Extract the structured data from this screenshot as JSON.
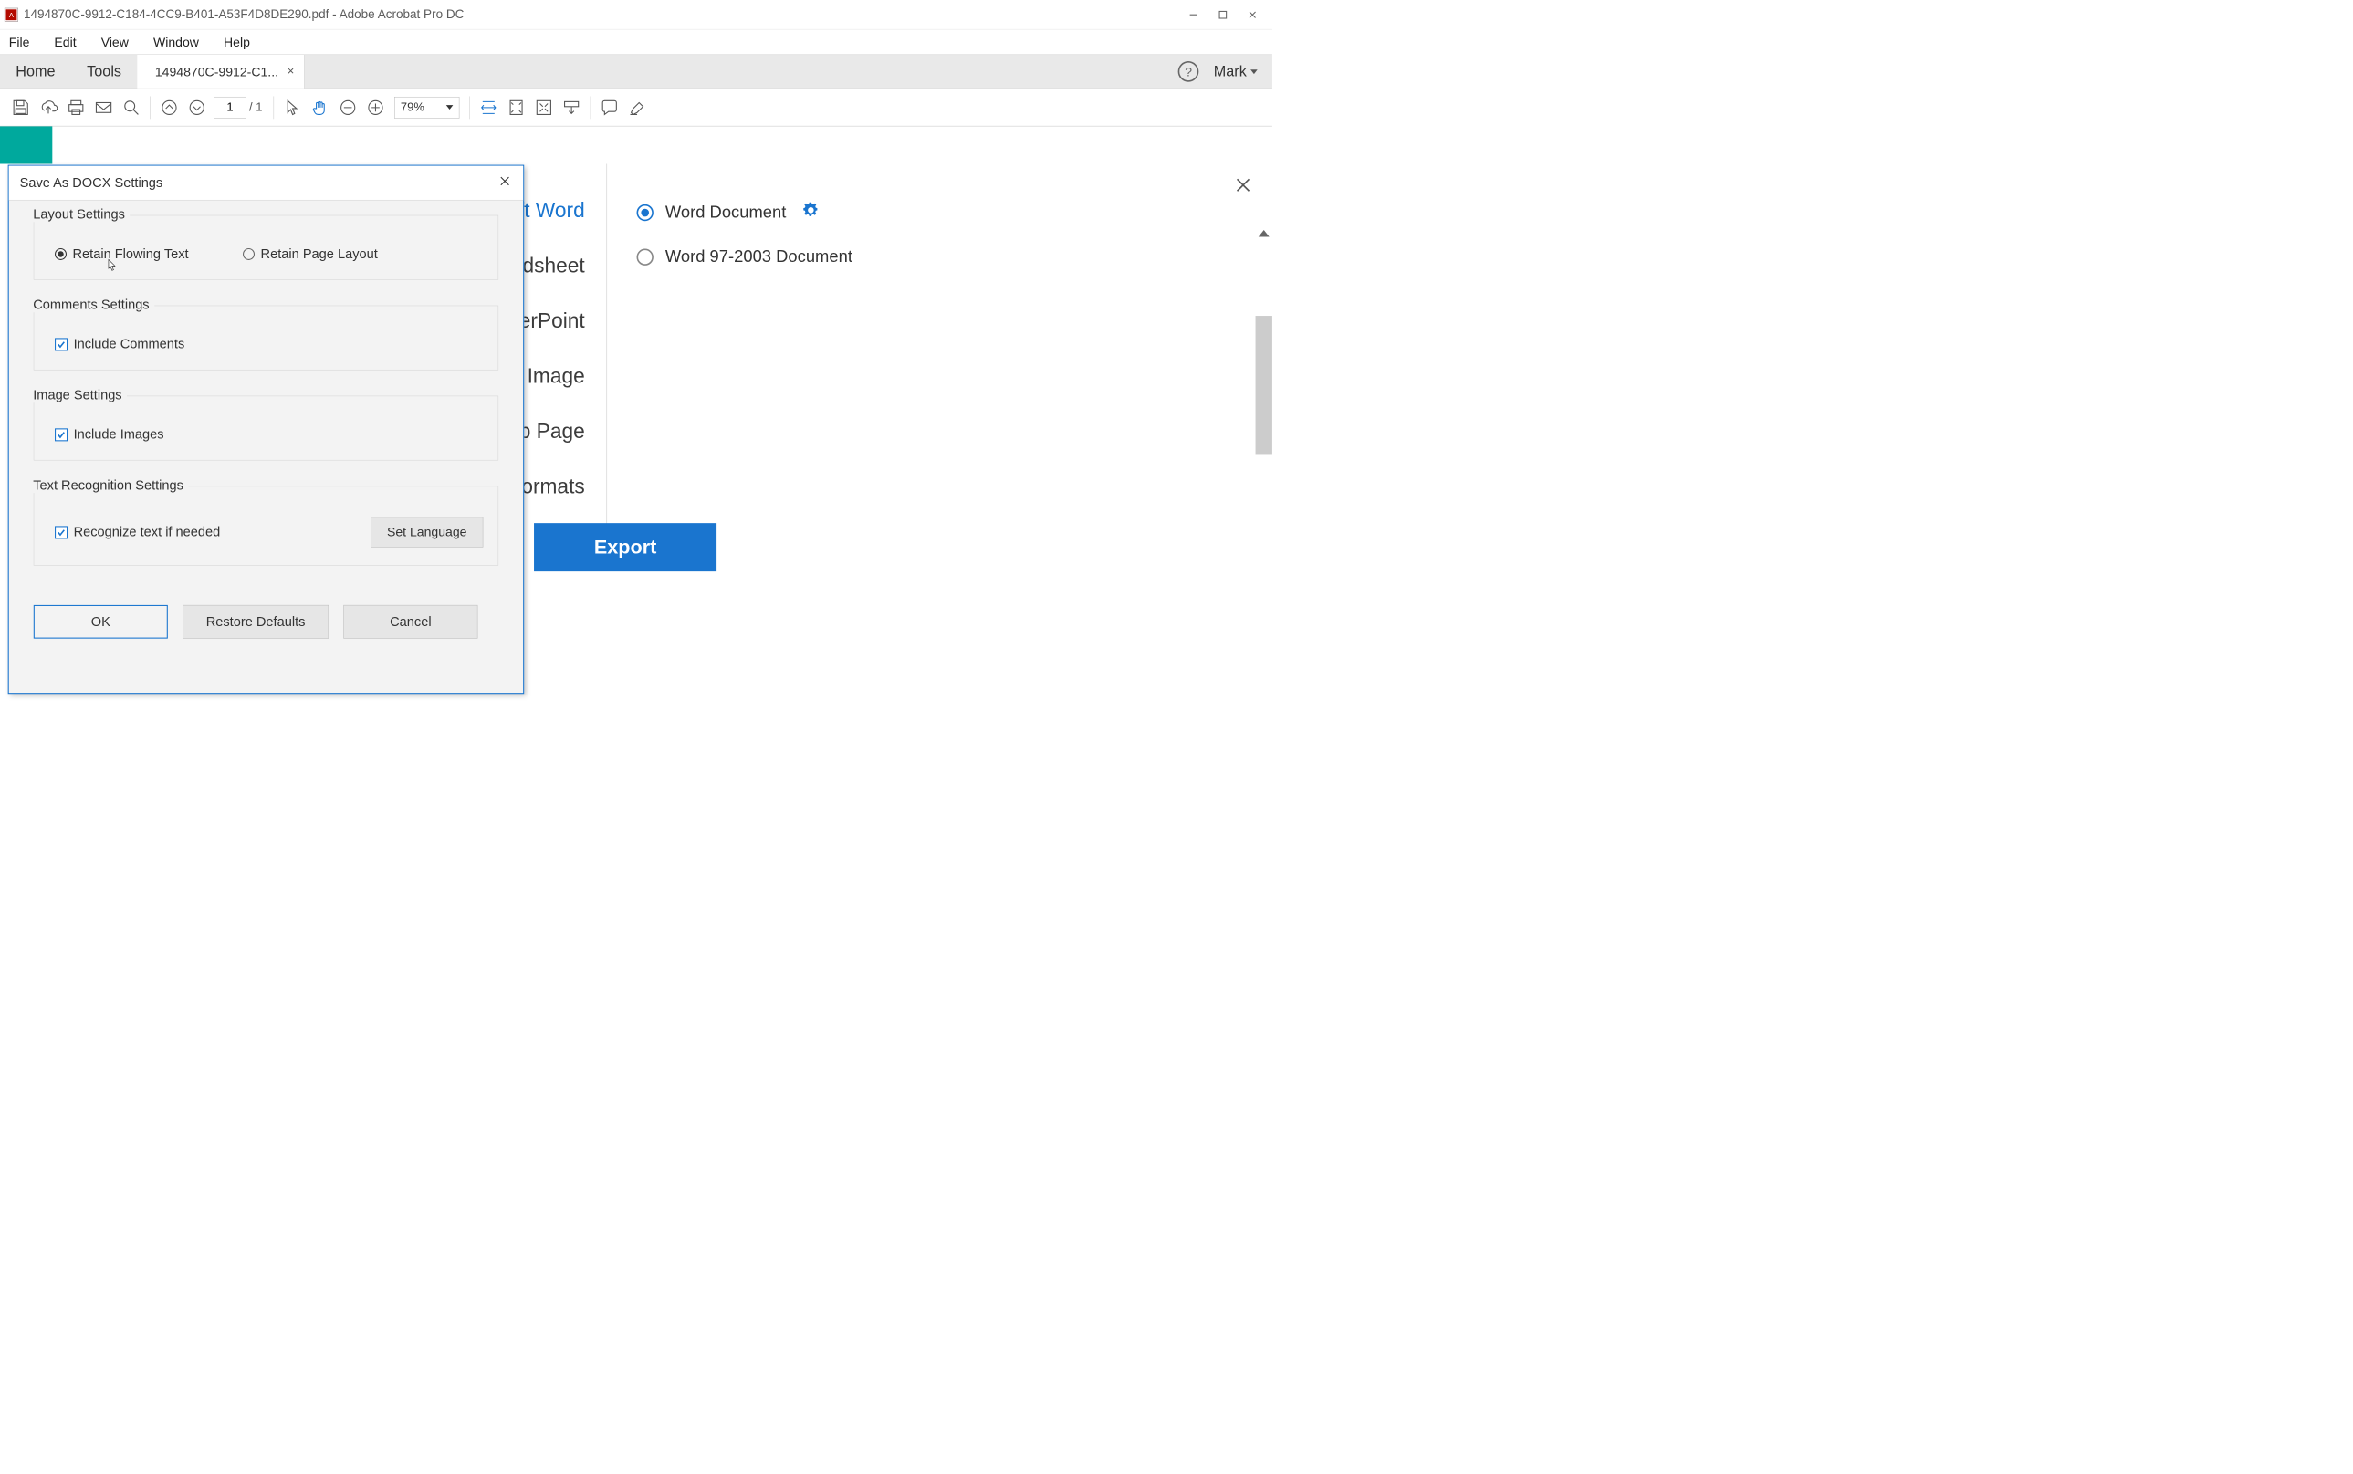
{
  "window": {
    "title": "1494870C-9912-C184-4CC9-B401-A53F4D8DE290.pdf - Adobe Acrobat Pro DC"
  },
  "menubar": {
    "items": [
      "File",
      "Edit",
      "View",
      "Window",
      "Help"
    ]
  },
  "tabs": {
    "home": "Home",
    "tools": "Tools",
    "doc": "1494870C-9912-C1...",
    "user": "Mark"
  },
  "toolbar": {
    "page_current": "1",
    "page_total": "/  1",
    "zoom": "79%"
  },
  "export": {
    "formats": {
      "word": "Microsoft Word",
      "spreadsheet": "Spreadsheet",
      "powerpoint": "osoft PowerPoint",
      "image": "Image",
      "html": "HTML Web Page",
      "more": "More Formats"
    },
    "sub": {
      "docx": "Word Document",
      "doc": "Word 97-2003 Document"
    },
    "button": "Export"
  },
  "dialog": {
    "title": "Save As DOCX Settings",
    "layout": {
      "legend": "Layout Settings",
      "flowing": "Retain Flowing Text",
      "page": "Retain Page Layout"
    },
    "comments": {
      "legend": "Comments Settings",
      "include": "Include Comments"
    },
    "images": {
      "legend": "Image Settings",
      "include": "Include Images"
    },
    "ocr": {
      "legend": "Text Recognition Settings",
      "recognize": "Recognize text if needed",
      "set_language": "Set Language"
    },
    "buttons": {
      "ok": "OK",
      "restore": "Restore Defaults",
      "cancel": "Cancel"
    }
  }
}
